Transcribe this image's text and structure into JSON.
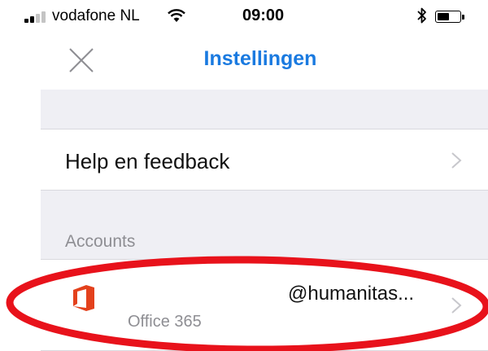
{
  "status_bar": {
    "carrier": "vodafone NL",
    "time": "09:00",
    "signal_bars_filled": 2,
    "signal_bars_total": 4,
    "battery_level": 0.55,
    "icons": [
      "signal-icon",
      "wifi-icon",
      "bluetooth-icon",
      "battery-icon"
    ]
  },
  "nav": {
    "title": "Instellingen",
    "close_icon": "close-icon"
  },
  "colors": {
    "accent": "#1a7ae0",
    "group_background": "#efeff4",
    "section_header": "#8e8e93",
    "office_red": "#e3411c",
    "annotation": "#e8121b",
    "chevron": "#c7c7cc"
  },
  "settings": {
    "help_row": {
      "label": "Help en feedback"
    },
    "accounts_header": "Accounts",
    "account": {
      "email": "@humanitas...",
      "type": "Office 365",
      "icon": "office-logo-icon"
    }
  }
}
